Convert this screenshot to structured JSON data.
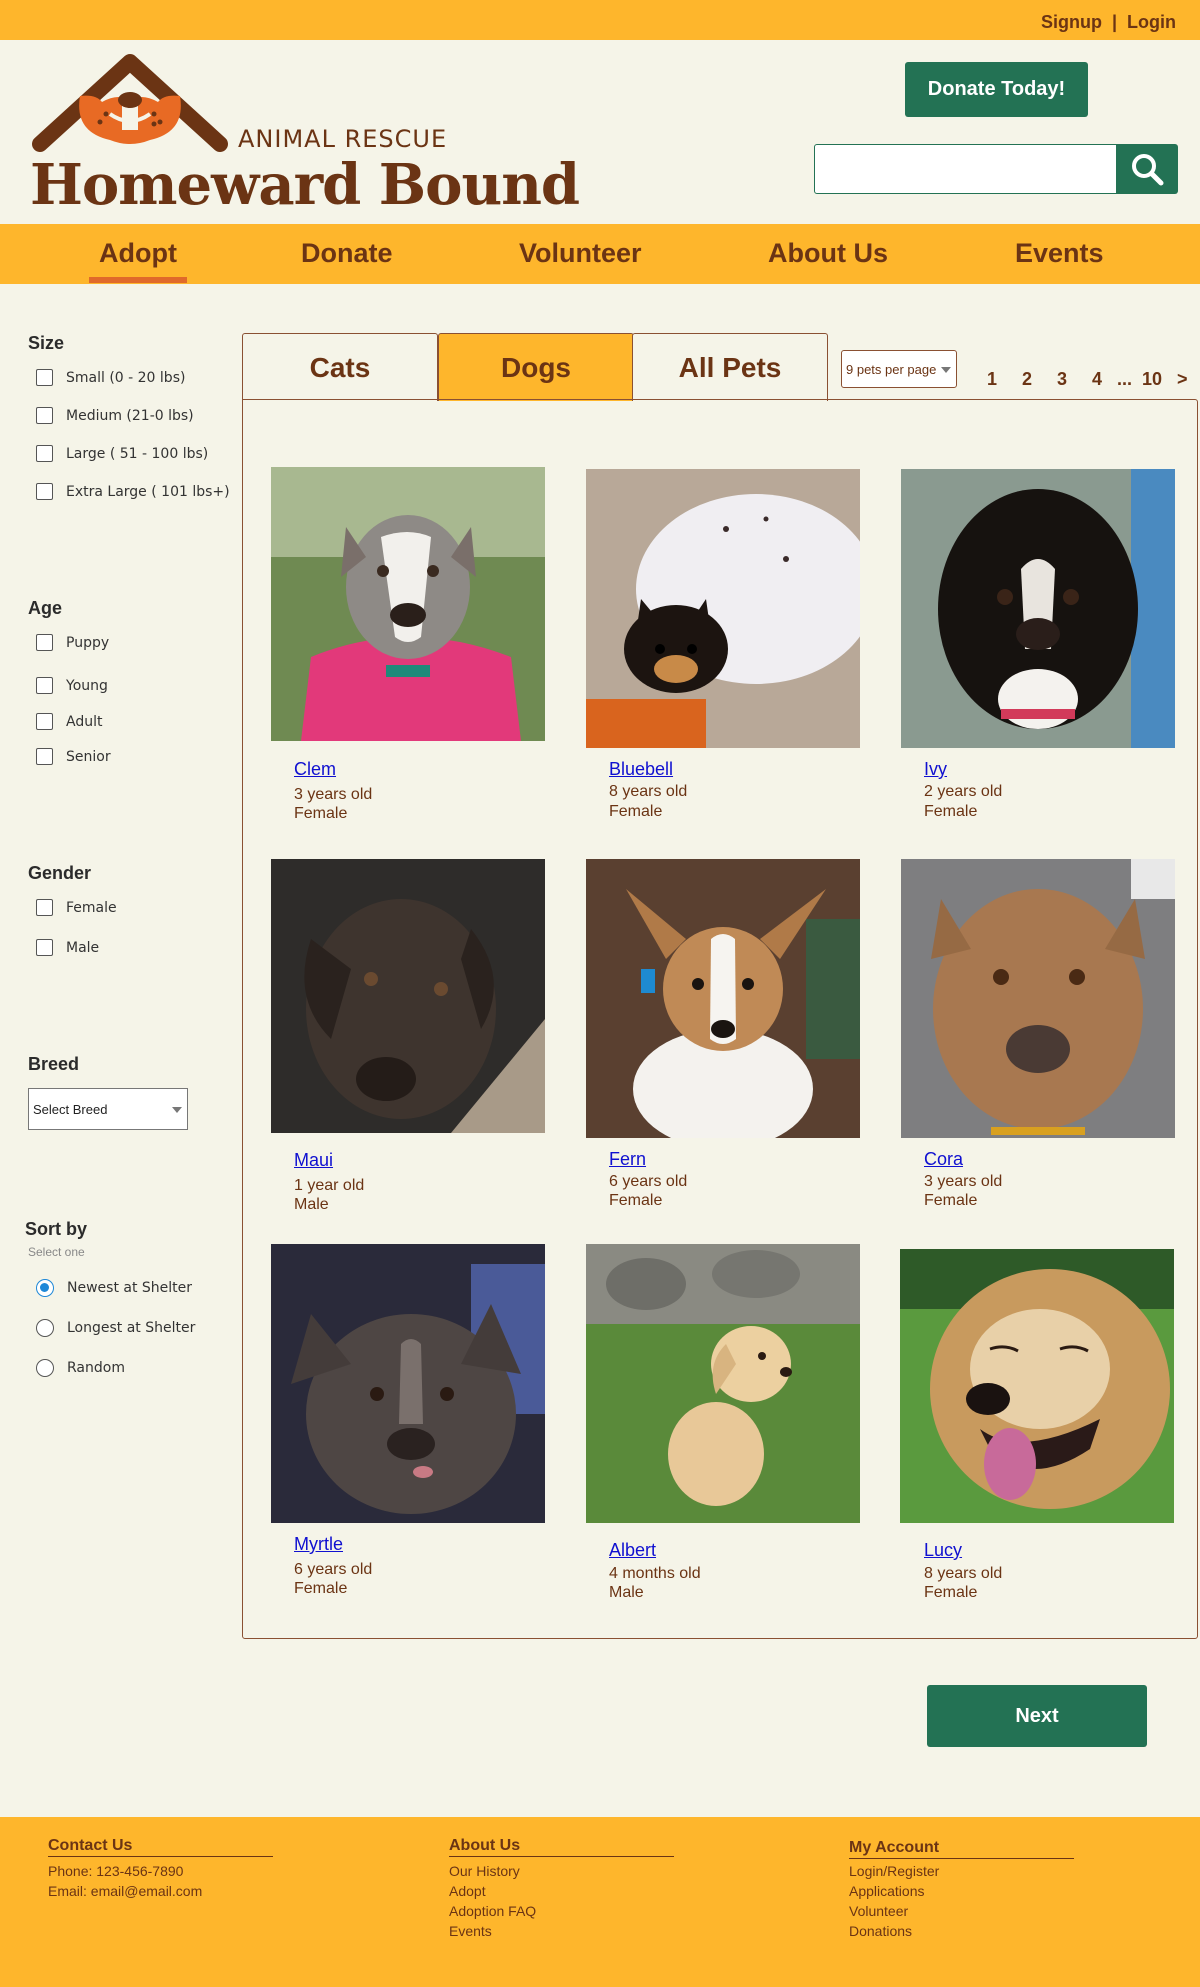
{
  "topbar": {
    "signup": "Signup",
    "separator": "|",
    "login": "Login"
  },
  "header": {
    "logo_subtitle": "ANIMAL RESCUE",
    "logo_title": "Homeward Bound",
    "donate_label": "Donate Today!",
    "search_placeholder": ""
  },
  "nav": [
    "Adopt",
    "Donate",
    "Volunteer",
    "About Us",
    "Events"
  ],
  "filters": {
    "size": {
      "title": "Size",
      "options": [
        "Small (0 - 20 lbs)",
        "Medium (21-0 lbs)",
        "Large ( 51 - 100 lbs)",
        "Extra Large ( 101 lbs+)"
      ]
    },
    "age": {
      "title": "Age",
      "options": [
        "Puppy",
        "Young",
        "Adult",
        "Senior"
      ]
    },
    "gender": {
      "title": "Gender",
      "options": [
        "Female",
        "Male"
      ]
    },
    "breed": {
      "title": "Breed",
      "selected": "Select Breed"
    },
    "sort": {
      "title": "Sort by",
      "subtitle": "Select one",
      "options": [
        "Newest at Shelter",
        "Longest at Shelter",
        "Random"
      ],
      "selected": "Newest at Shelter"
    }
  },
  "tabs": [
    "Cats",
    "Dogs",
    "All Pets"
  ],
  "active_tab": "Dogs",
  "per_page": "9 pets per page",
  "pagination": [
    "1",
    "2",
    "3",
    "4",
    "...",
    "10",
    ">"
  ],
  "pets": [
    {
      "name": "Clem",
      "age": "3 years old",
      "gender": "Female"
    },
    {
      "name": "Bluebell",
      "age": "8 years old",
      "gender": "Female"
    },
    {
      "name": "Ivy",
      "age": "2 years old",
      "gender": "Female"
    },
    {
      "name": "Maui",
      "age": "1 year old",
      "gender": "Male"
    },
    {
      "name": "Fern",
      "age": "6 years old",
      "gender": "Female"
    },
    {
      "name": "Cora",
      "age": "3 years old",
      "gender": "Female"
    },
    {
      "name": "Myrtle",
      "age": "6 years old",
      "gender": "Female"
    },
    {
      "name": "Albert",
      "age": "4 months old",
      "gender": "Male"
    },
    {
      "name": "Lucy",
      "age": "8 years old",
      "gender": "Female"
    }
  ],
  "next_label": "Next",
  "footer": {
    "contact": {
      "title": "Contact Us",
      "phone": "Phone: 123-456-7890",
      "email": "Email: email@email.com"
    },
    "about": {
      "title": "About Us",
      "links": [
        "Our History",
        "Adopt",
        "Adoption FAQ",
        "Events"
      ]
    },
    "account": {
      "title": "My Account",
      "links": [
        "Login/Register",
        "Applications",
        "Volunteer",
        "Donations"
      ]
    }
  },
  "colors": {
    "accent": "#feb62c",
    "brand": "#6b3414",
    "button": "#237254",
    "background": "#f5f4e8",
    "tab_underline": "#e06a2a"
  }
}
